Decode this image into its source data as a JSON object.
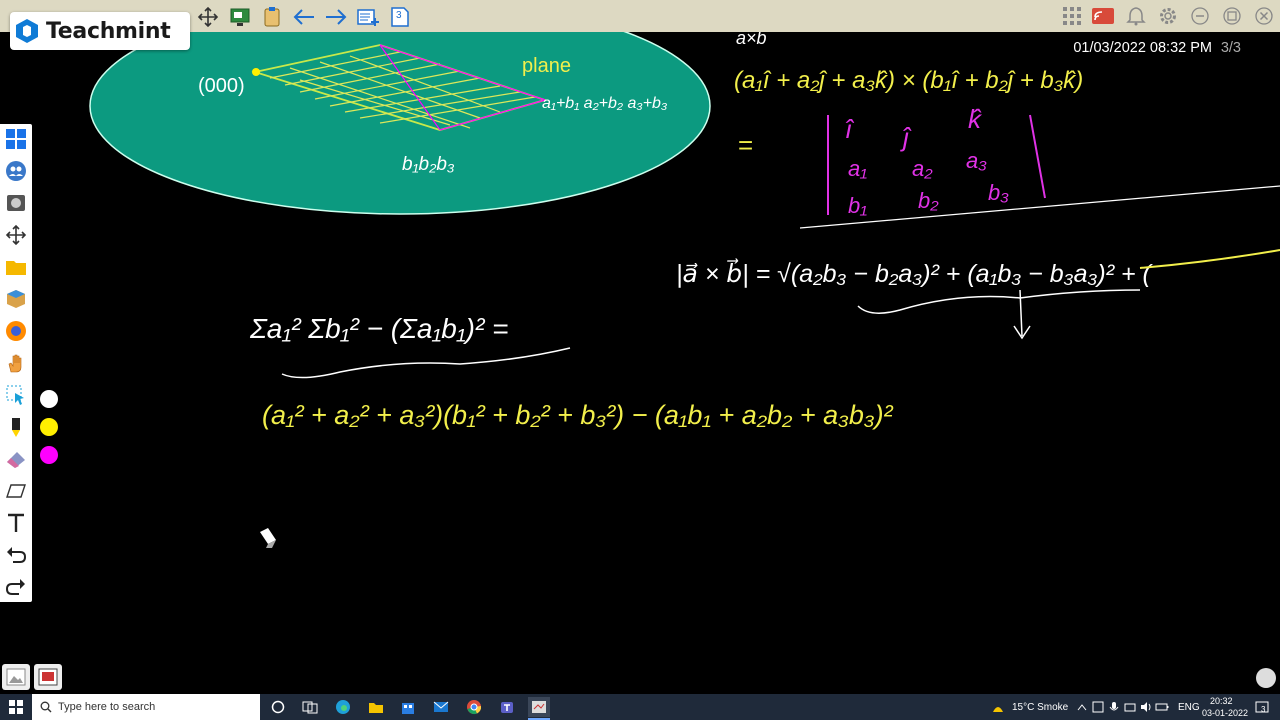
{
  "app": {
    "brand_name": "Teachmint",
    "accent": "#0f7bd6"
  },
  "status": {
    "datetime": "01/03/2022 08:32 PM",
    "page": "3/3"
  },
  "toolbar": {
    "tools": [
      "move-icon",
      "screen-share-icon",
      "clipboard-icon",
      "arrow-left-icon",
      "arrow-right-icon",
      "add-page-icon",
      "page-3-icon"
    ],
    "page_badge": "3",
    "right": [
      "apps-grid-icon",
      "cast-icon",
      "bell-icon",
      "gear-icon",
      "minimize-icon",
      "maximize-icon",
      "close-icon"
    ]
  },
  "left_tools": [
    "windows-icon",
    "group-icon",
    "capture-icon",
    "pan-icon",
    "folder-icon",
    "box-icon",
    "firefox-icon",
    "hand-icon",
    "select-icon",
    "pen-icon",
    "eraser-icon",
    "shape-icon",
    "text-icon",
    "undo-icon",
    "redo-icon"
  ],
  "colors": {
    "white": "#ffffff",
    "yellow": "#ffef00",
    "magenta": "#ff00ff",
    "ellipse": "#0c9a80",
    "ink_yellow": "#f2ef4b",
    "ink_magenta": "#e032e6"
  },
  "board": {
    "labels": {
      "origin": "(000)",
      "plane": "plane",
      "corner": "a₁+b₁ a₂+b₂ a₃+b₃",
      "vertex": "b₁b₂b₃",
      "axb": "a×b",
      "a_hat": "a"
    },
    "cross_expansion": "(a₁î + a₂ĵ + a₃k̂) × (b₁î + b₂ĵ + b₃k̂)",
    "equals": "=",
    "det_headers": [
      "î",
      "ĵ",
      "k̂"
    ],
    "det_row_a": [
      "a₁",
      "a₂",
      "a₃"
    ],
    "det_row_b": [
      "b₁",
      "b₂",
      "b₃"
    ],
    "magnitude": "|a⃗ × b⃗| = √(a₂b₃ − b₂a₃)² + (a₁b₃ − b₃a₃)² + (",
    "sum_identity": "Σa₁² Σb₁² − (Σa₁b₁)² =",
    "expansion": "(a₁² + a₂² + a₃²)(b₁² + b₂² + b₃²) − (a₁b₁ + a₂b₂ + a₃b₃)²"
  },
  "taskbar": {
    "search_placeholder": "Type here to search",
    "weather": "15°C Smoke",
    "lang": "ENG",
    "time": "20:32",
    "date": "03-01-2022",
    "notif_count": "3"
  }
}
